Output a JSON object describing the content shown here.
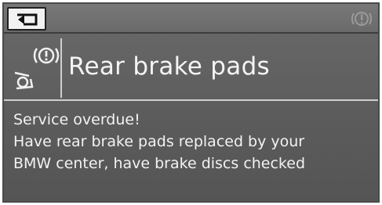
{
  "header": {
    "back_icon": "back-arrow-icon",
    "warning_icon": "service-warning-icon"
  },
  "notification": {
    "icon": "brake-pads-warning-icon",
    "title": "Rear brake pads",
    "lines": [
      "Service overdue!",
      "Have rear brake pads replaced by your",
      "BMW center, have brake discs checked"
    ]
  },
  "colors": {
    "panel_bg": "#5f5f5f",
    "text": "#f2f2f2",
    "button_bg": "#f2f2f2"
  }
}
